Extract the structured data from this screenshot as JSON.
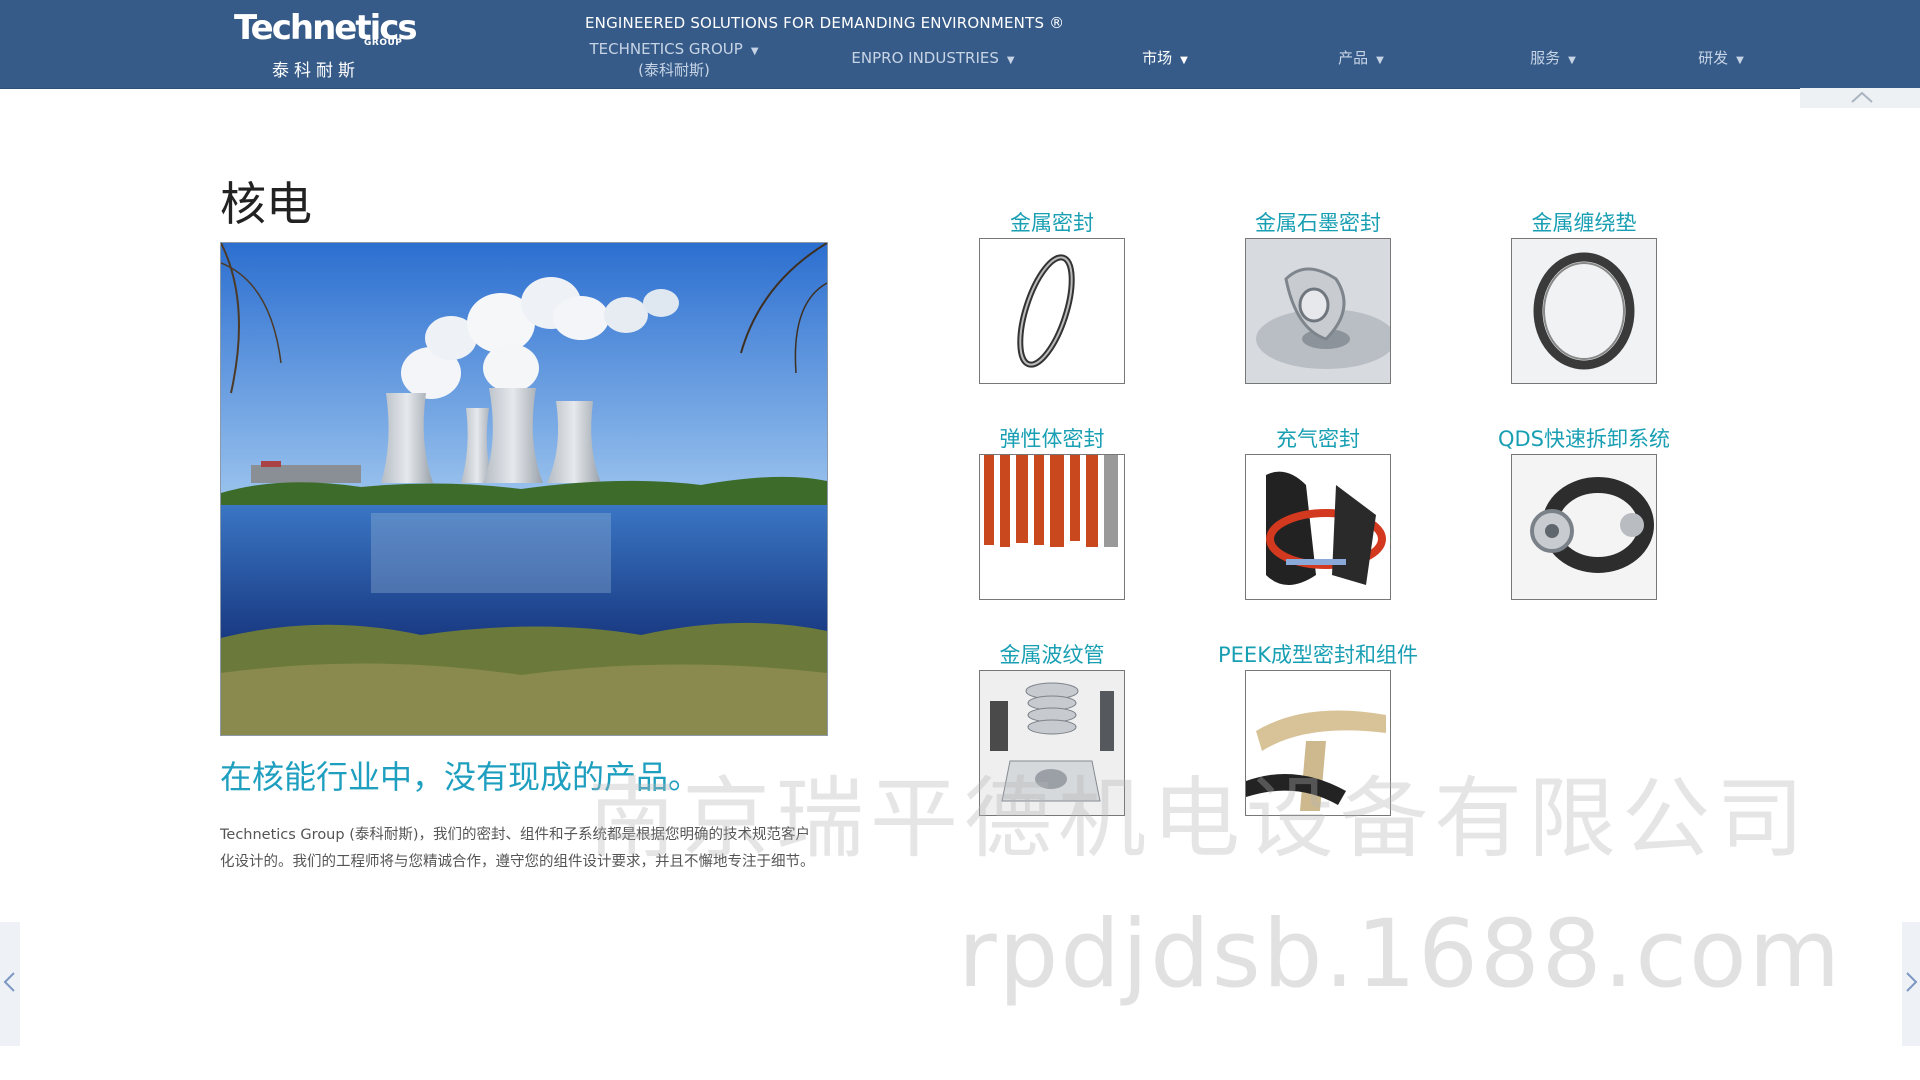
{
  "header": {
    "logo_word": "Technetics",
    "logo_group": "GROUP",
    "logo_cn": "泰科耐斯",
    "tagline": "ENGINEERED SOLUTIONS FOR DEMANDING ENVIRONMENTS ®",
    "nav": [
      {
        "label": "TECHNETICS GROUP",
        "sublabel": "(泰科耐斯)"
      },
      {
        "label": "ENPRO INDUSTRIES"
      },
      {
        "label": "市场"
      },
      {
        "label": "产品"
      },
      {
        "label": "服务"
      },
      {
        "label": "研发"
      }
    ],
    "caret": "▼"
  },
  "main": {
    "title": "核电",
    "subhead": "在核能行业中，没有现成的产品。",
    "body": "Technetics Group (泰科耐斯)，我们的密封、组件和子系统都是根据您明确的技术规范客户化设计的。我们的工程师将与您精诚合作，遵守您的组件设计要求，并且不懈地专注于细节。"
  },
  "products": [
    {
      "label": "金属密封",
      "icon": "metal-seal-ring"
    },
    {
      "label": "金属石墨密封",
      "icon": "metal-graphite-seal"
    },
    {
      "label": "金属缠绕垫",
      "icon": "spiral-wound-gasket"
    },
    {
      "label": "弹性体密封",
      "icon": "elastomer-profiles"
    },
    {
      "label": "充气密封",
      "icon": "inflatable-seal"
    },
    {
      "label": "QDS快速拆卸系统",
      "icon": "quick-disconnect-clamp"
    },
    {
      "label": "金属波纹管",
      "icon": "metal-bellows"
    },
    {
      "label": "PEEK成型密封和组件",
      "icon": "peek-seal-parts"
    }
  ],
  "watermark": {
    "company": "南京瑞平德机电设备有限公司",
    "url": "rpdjdsb.1688.com"
  },
  "colors": {
    "header_bg": "#365b88",
    "accent": "#199fb3"
  }
}
